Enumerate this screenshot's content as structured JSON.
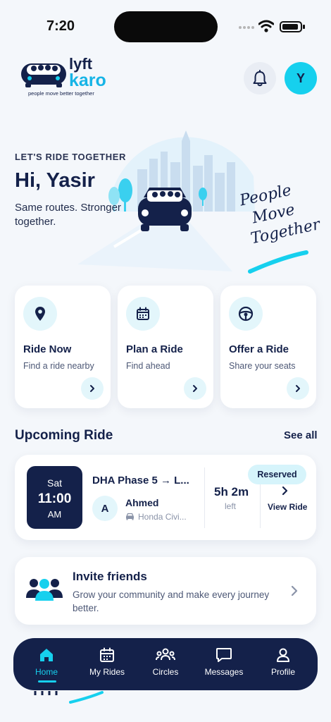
{
  "status_bar": {
    "time": "7:20"
  },
  "header": {
    "logo_word_top": "lyft",
    "logo_word_bottom": "karo",
    "logo_tagline": "people move better together",
    "avatar_initial": "Y",
    "bell_icon": "bell-icon"
  },
  "hero": {
    "eyebrow": "LET'S RIDE TOGETHER",
    "greeting": "Hi, Yasir",
    "subtext": "Same routes. Stronger together.",
    "art_caption_line1": "People",
    "art_caption_line2": "Move",
    "art_caption_line3": "Together"
  },
  "quick_actions": [
    {
      "title": "Ride Now",
      "subtitle": "Find a ride nearby",
      "icon": "location-pin-icon"
    },
    {
      "title": "Plan a Ride",
      "subtitle": "Find ahead",
      "icon": "calendar-icon"
    },
    {
      "title": "Offer a Ride",
      "subtitle": "Share your seats",
      "icon": "steering-wheel-icon"
    }
  ],
  "upcoming": {
    "section_title": "Upcoming Ride",
    "see_all": "See all",
    "ride": {
      "day": "Sat",
      "time": "11:00",
      "ampm": "AM",
      "route": "DHA Phase 5 → L...",
      "driver_initial": "A",
      "driver_name": "Ahmed",
      "car": "Honda Civi...",
      "eta": "5h 2m",
      "eta_label": "left",
      "status": "Reserved",
      "action": "View Ride"
    }
  },
  "invite": {
    "title": "Invite friends",
    "description": "Grow your community and make every journey better."
  },
  "nav": {
    "items": [
      {
        "label": "Home",
        "icon": "home-icon",
        "active": true
      },
      {
        "label": "My Rides",
        "icon": "calendar-icon"
      },
      {
        "label": "Circles",
        "icon": "group-icon"
      },
      {
        "label": "Messages",
        "icon": "chat-icon"
      },
      {
        "label": "Profile",
        "icon": "user-icon"
      }
    ]
  },
  "colors": {
    "navy": "#14214a",
    "cyan": "#16d0ee",
    "light_cyan": "#e3f6fb",
    "background": "#f4f7fb"
  }
}
